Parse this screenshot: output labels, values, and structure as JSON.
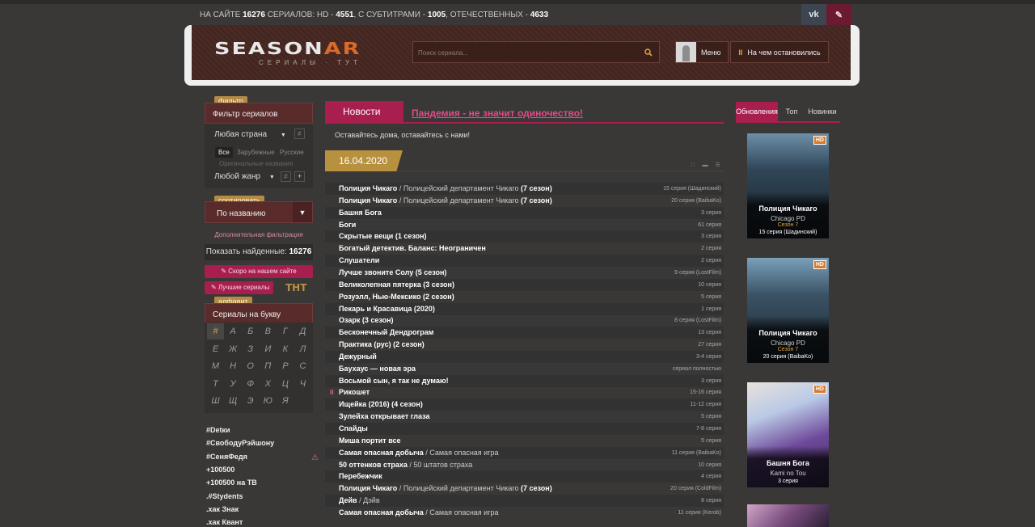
{
  "top": {
    "stats_prefix": "НА САЙТЕ",
    "total": "16276",
    "stats_mid1": "СЕРИАЛОВ: HD -",
    "hd": "4551",
    "stats_mid2": ", С СУБТИТРАМИ -",
    "subs": "1005",
    "stats_mid3": ", ОТЕЧЕСТВЕННЫХ -",
    "domestic": "4633",
    "vk_label": "vk"
  },
  "header": {
    "logo_part1": "SEASON",
    "logo_part2": "AR",
    "logo_sub": "СЕРИАЛЫ · ТУТ",
    "search_placeholder": "Поиск сериала...",
    "menu_label": "Меню",
    "last_label": "На чем остановились"
  },
  "left": {
    "filter_tag": "фильтр",
    "filter_title": "Фильтр сериалов",
    "country_select": "Любая страна",
    "country_tabs": [
      "Все",
      "Зарубежные",
      "Русские"
    ],
    "original_names": "Оригинальные названия",
    "genre_select": "Любой жанр",
    "sort_tag": "сортировать",
    "sort_select": "По названию",
    "advanced_link": "Дополнительная фильтрация",
    "found_label": "Показать найденные:",
    "found_count": "16276",
    "soon_button": "Скоро на нашем сайте",
    "best_button": "Лучшие сериалы",
    "tnt_label": "ТНТ",
    "alpha_tag": "алфавит",
    "alpha_title": "Сериалы на букву",
    "letters": [
      "#",
      "А",
      "Б",
      "В",
      "Г",
      "Д",
      "Е",
      "Ж",
      "З",
      "И",
      "К",
      "Л",
      "М",
      "Н",
      "О",
      "П",
      "Р",
      "С",
      "Т",
      "У",
      "Ф",
      "Х",
      "Ц",
      "Ч",
      "Ш",
      "Щ",
      "Э",
      "Ю",
      "Я"
    ],
    "tags": [
      "#Detки",
      "#СвободуРэйшону",
      "#СеняФедя",
      "+100500",
      "+100500 на ТВ",
      ".#Stуdents",
      ".хак Знак",
      ".хак Квант"
    ]
  },
  "center": {
    "news_tab": "Новости",
    "news_link": "Пандемия - не значит одиночество!",
    "news_text": "Оставайтесь дома, оставайтесь с нами!",
    "date": "16.04.2020",
    "episodes": [
      {
        "title": "Полиция Чикаго",
        "alt": "Полицейский департамент Чикаго",
        "season": "(7 сезон)",
        "count": "15 серия (Шадинский)"
      },
      {
        "title": "Полиция Чикаго",
        "alt": "Полицейский департамент Чикаго",
        "season": "(7 сезон)",
        "count": "20 серия (BaibaKo)"
      },
      {
        "title": "Башня Бога",
        "alt": "",
        "season": "",
        "count": "3 серия"
      },
      {
        "title": "Боги",
        "alt": "",
        "season": "",
        "count": "61 серия"
      },
      {
        "title": "Скрытые вещи (1 сезон)",
        "alt": "",
        "season": "",
        "count": "3 серия"
      },
      {
        "title": "Богатый детектив. Баланс: Неограничен",
        "alt": "",
        "season": "",
        "count": "2 серия"
      },
      {
        "title": "Слушатели",
        "alt": "",
        "season": "",
        "count": "2 серия"
      },
      {
        "title": "Лучше звоните Солу (5 сезон)",
        "alt": "",
        "season": "",
        "count": "9 серия (LostFilm)"
      },
      {
        "title": "Великолепная пятерка (3 сезон)",
        "alt": "",
        "season": "",
        "count": "10 серия"
      },
      {
        "title": "Розуэлл, Нью-Мексико (2 сезон)",
        "alt": "",
        "season": "",
        "count": "5 серия"
      },
      {
        "title": "Пекарь и Красавица (2020)",
        "alt": "",
        "season": "",
        "count": "1 серия"
      },
      {
        "title": "Озарк (3 сезон)",
        "alt": "",
        "season": "",
        "count": "8 серия (LostFilm)"
      },
      {
        "title": "Бесконечный Дендрограм",
        "alt": "",
        "season": "",
        "count": "13 серия"
      },
      {
        "title": "Практика (рус) (2 сезон)",
        "alt": "",
        "season": "",
        "count": "27 серия"
      },
      {
        "title": "Дежурный",
        "alt": "",
        "season": "",
        "count": "3-4 серия"
      },
      {
        "title": "Баухаус — новая эра",
        "alt": "",
        "season": "",
        "count": "сериал полностью"
      },
      {
        "title": "Восьмой сын, я так не думаю!",
        "alt": "",
        "season": "",
        "count": "3 серия"
      },
      {
        "title": "Рикошет",
        "alt": "",
        "season": "",
        "count": "15-16 серия"
      },
      {
        "title": "Ищейка (2016) (4 сезон)",
        "alt": "",
        "season": "",
        "count": "11-12 серия"
      },
      {
        "title": "Зулейха открывает глаза",
        "alt": "",
        "season": "",
        "count": "5 серия"
      },
      {
        "title": "Спайды",
        "alt": "",
        "season": "",
        "count": "7-8 серия"
      },
      {
        "title": "Миша портит все",
        "alt": "",
        "season": "",
        "count": "5 серия"
      },
      {
        "title": "Самая опасная добыча",
        "alt": "Самая опасная игра",
        "season": "",
        "count": "11 серия (BaibaKo)"
      },
      {
        "title": "50 оттенков страха",
        "alt": "50 штатов страха",
        "season": "",
        "count": "10 серия"
      },
      {
        "title": "Перебежчик",
        "alt": "",
        "season": "",
        "count": "4 серия"
      },
      {
        "title": "Полиция Чикаго",
        "alt": "Полицейский департамент Чикаго",
        "season": "(7 сезон)",
        "count": "20 серия (ColdFilm)"
      },
      {
        "title": "Дейв",
        "alt": "Дэйв",
        "season": "",
        "count": "8 серия"
      },
      {
        "title": "Самая опасная добыча",
        "alt": "Самая опасная игра",
        "season": "",
        "count": "11 серия (Kerob)"
      }
    ]
  },
  "right": {
    "tabs": [
      "Обновления",
      "Топ",
      "Новинки"
    ],
    "cards": [
      {
        "title": "Полиция Чикаго",
        "orig": "Chicago PD",
        "season": "Сезон 7",
        "episode": "15 серия (Шадинский)",
        "hd": "HD"
      },
      {
        "title": "Полиция Чикаго",
        "orig": "Chicago PD",
        "season": "Сезон 7",
        "episode": "20 серия (BaibaKo)",
        "hd": "HD"
      },
      {
        "title": "Башня Бога",
        "orig": "Kami no Tou",
        "season": "",
        "episode": "3 серия",
        "hd": "HD"
      }
    ]
  }
}
